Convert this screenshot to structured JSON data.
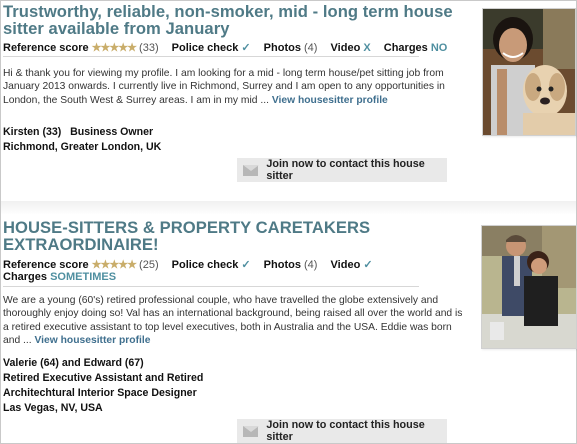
{
  "listings": [
    {
      "title_line1": "Trustworthy, reliable, non-smoker, mid - long term house",
      "title_line2": "sitter available from January",
      "ref_label": "Reference score",
      "stars": "★★★★★",
      "rating": 5,
      "ref_count": "(33)",
      "police_label": "Police check",
      "check": "✓",
      "photos_label": "Photos",
      "photos_count": "(4)",
      "video_label": "Video",
      "video_value": "X",
      "charges_label": "Charges",
      "charges_value": "NO",
      "description": "Hi & thank you for viewing my profile. I am looking for a mid - long term house/pet sitting job from January 2013 onwards. I currently live in Richmond, Surrey and I am open to any opportunities in London, the South West & Surrey areas. I am in my mid ...",
      "view_link": "View housesitter profile",
      "info_line1": "Kirsten (33)",
      "info_line1b": "Business Owner",
      "info_line2": "Richmond, Greater London, UK",
      "contact_label": "Join now to contact this house sitter"
    },
    {
      "title_line1": "HOUSE-SITTERS & PROPERTY CARETAKERS",
      "title_line2": "EXTRAORDINAIRE!",
      "ref_label": "Reference score",
      "stars": "★★★★★",
      "rating": 5,
      "ref_count": "(25)",
      "police_label": "Police check",
      "check": "✓",
      "photos_label": "Photos",
      "photos_count": "(4)",
      "video_label": "Video",
      "video_value": "✓",
      "charges_label": "Charges",
      "charges_value": "SOMETIMES",
      "description": "We are a young (60's) retired professional couple, who have travelled the globe extensively and thoroughly enjoy doing so! Val has an international background, being raised all over the world and is a retired executive assistant to top level executives, both in Australia and the USA. Eddie was born and ...",
      "view_link": "View housesitter profile",
      "info_line1": "Valerie (64) and Edward (67)",
      "info_line2": "Retired Executive Assistant and Retired",
      "info_line3": "Architechtural Interior Space Designer",
      "info_line4": "Las Vegas, NV, USA",
      "contact_label": "Join now to contact this house sitter"
    }
  ],
  "colors": {
    "title": "#4f7a86",
    "accent": "#4f8fa0",
    "link": "#3f6f8e",
    "stars": "#c9ad6a"
  },
  "icons": {
    "contact": "envelope-icon",
    "photo1": "woman-with-dog-photo",
    "photo2": "couple-photo"
  }
}
